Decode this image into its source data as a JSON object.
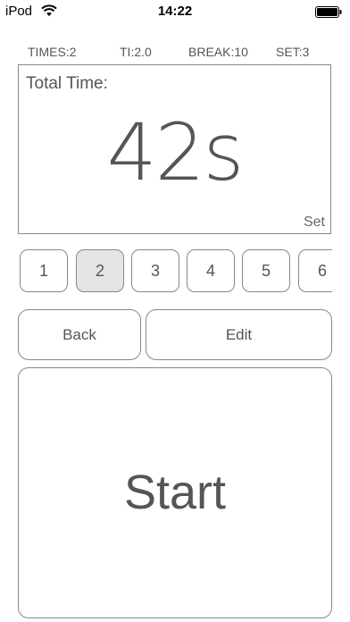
{
  "status_bar": {
    "carrier": "iPod",
    "time": "14:22",
    "wifi_icon": "wifi-icon",
    "battery_icon": "battery-icon"
  },
  "info": {
    "times": "TIMES:2",
    "ti": "TI:2.0",
    "break": "BREAK:10",
    "set": "SET:3"
  },
  "display": {
    "total_label": "Total Time:",
    "value": "42s",
    "set_label": "Set"
  },
  "numbers": {
    "items": [
      "1",
      "2",
      "3",
      "4",
      "5",
      "6"
    ],
    "selected": "2"
  },
  "buttons": {
    "back": "Back",
    "edit": "Edit",
    "start": "Start"
  },
  "colors": {
    "border": "#888888",
    "selected_bg": "#e4e4e4",
    "text": "#555555"
  }
}
